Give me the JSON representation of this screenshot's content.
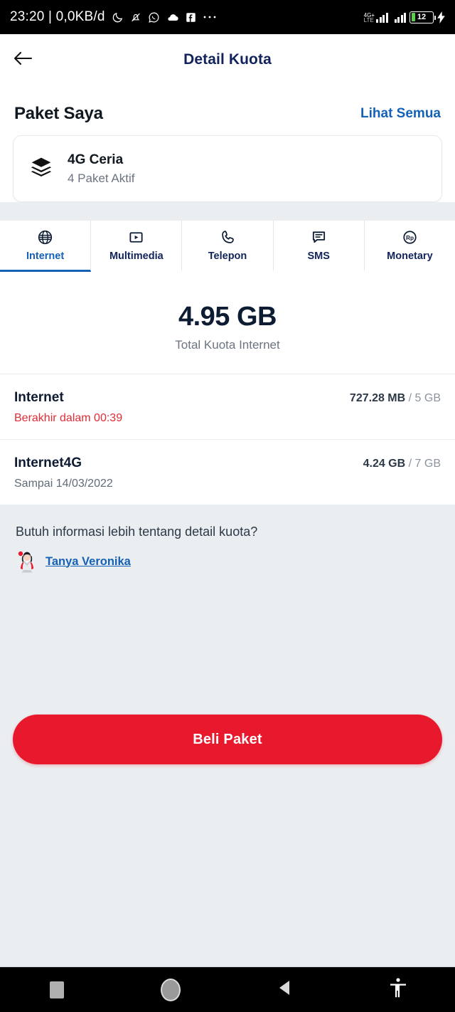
{
  "statusbar": {
    "time_and_data": "23:20 | 0,0KB/d",
    "icons": [
      "moon-icon",
      "bell-muted-icon",
      "whatsapp-icon",
      "cloud-icon",
      "facebook-icon",
      "more-dots-icon"
    ],
    "network_label": "4G+",
    "network_sub": "LTE",
    "battery_level": "12",
    "charging": true
  },
  "appbar": {
    "back_icon": "arrow-left-icon",
    "title": "Detail Kuota"
  },
  "packages": {
    "section_title": "Paket Saya",
    "see_all_label": "Lihat Semua",
    "card": {
      "icon": "layers-icon",
      "name": "4G Ceria",
      "subtitle": "4 Paket Aktif"
    }
  },
  "tabs": [
    {
      "label": "Internet",
      "icon": "globe-icon",
      "active": true
    },
    {
      "label": "Multimedia",
      "icon": "play-box-icon",
      "active": false
    },
    {
      "label": "Telepon",
      "icon": "phone-icon",
      "active": false
    },
    {
      "label": "SMS",
      "icon": "chat-bubble-icon",
      "active": false
    },
    {
      "label": "Monetary",
      "icon": "rupiah-circle-icon",
      "active": false
    }
  ],
  "total": {
    "value": "4.95 GB",
    "label": "Total Kuota Internet"
  },
  "quota_rows": [
    {
      "name": "Internet",
      "sub": "Berakhir dalam 00:39",
      "sub_style": "danger",
      "used": "727.28 MB",
      "total": "/ 5 GB"
    },
    {
      "name": "Internet4G",
      "sub": "Sampai 14/03/2022",
      "sub_style": "muted",
      "used": "4.24 GB",
      "total": "/ 7 GB"
    }
  ],
  "help": {
    "question": "Butuh informasi lebih tentang detail kuota?",
    "avatar": "veronika-avatar",
    "link_label": "Tanya Veronika"
  },
  "cta": {
    "label": "Beli Paket"
  },
  "navbar": {
    "recents": "square-recents-icon",
    "home": "circle-home-icon",
    "back": "triangle-back-icon",
    "accessibility": "accessibility-icon"
  },
  "colors": {
    "brand_red": "#e8192c",
    "link_blue": "#1461b5",
    "navy": "#11235a",
    "page_bg": "#eaeef1",
    "danger": "#e02b36"
  }
}
